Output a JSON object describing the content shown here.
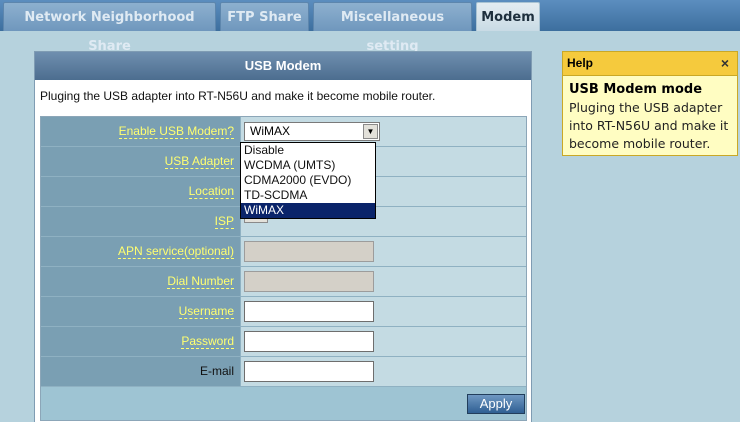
{
  "tabs": [
    {
      "label": "Network Neighborhood Share"
    },
    {
      "label": "FTP Share"
    },
    {
      "label": "Miscellaneous setting"
    },
    {
      "label": "Modem"
    }
  ],
  "panel": {
    "title": "USB Modem",
    "description": "Pluging the USB adapter into RT-N56U and make it become mobile router."
  },
  "form": {
    "enable_label": "Enable USB Modem?",
    "enable_value": "WiMAX",
    "enable_options": [
      "Disable",
      "WCDMA (UMTS)",
      "CDMA2000 (EVDO)",
      "TD-SCDMA",
      "WiMAX"
    ],
    "usb_adapter_label": "USB Adapter",
    "location_label": "Location",
    "isp_label": "ISP",
    "apn_label": "APN service(optional)",
    "dial_label": "Dial Number",
    "username_label": "Username",
    "password_label": "Password",
    "email_label": "E-mail",
    "apply_label": "Apply"
  },
  "help": {
    "header": "Help",
    "close": "×",
    "title": "USB Modem mode",
    "body": "Pluging the USB adapter into RT-N56U and make it become mobile router."
  }
}
